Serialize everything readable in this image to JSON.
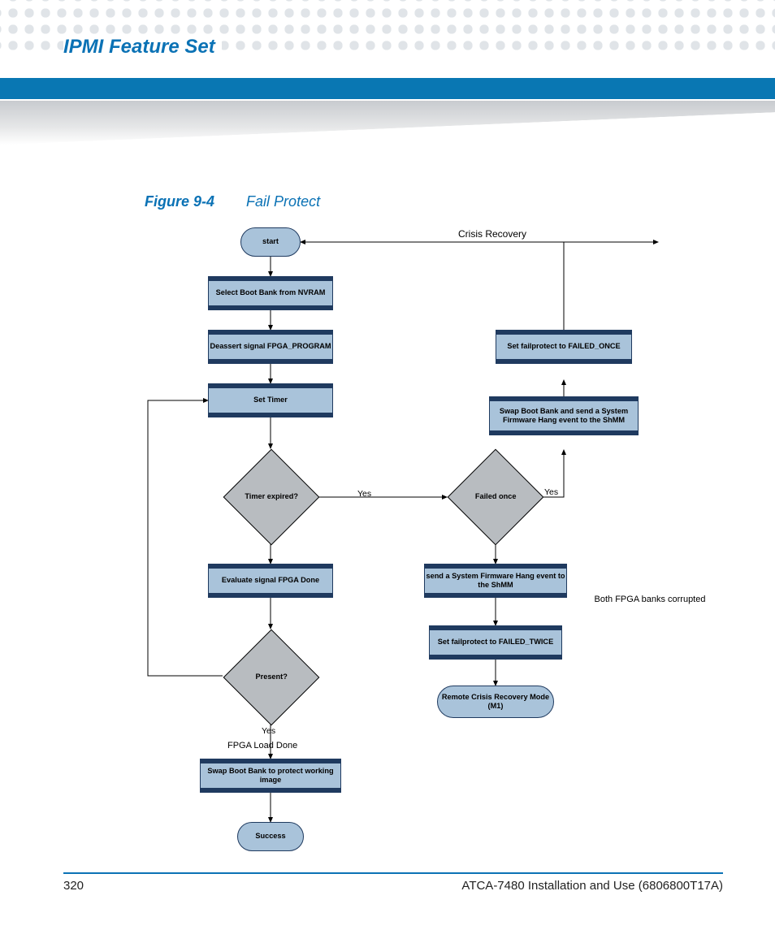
{
  "header": {
    "section_title": "IPMI Feature Set"
  },
  "figure": {
    "number": "Figure 9-4",
    "title": "Fail Protect"
  },
  "flow": {
    "start": "start",
    "select_boot": "Select Boot Bank from NVRAM",
    "deassert": "Deassert signal FPGA_PROGRAM",
    "set_timer": "Set Timer",
    "timer_expired": "Timer expired?",
    "eval_fpga": "Evaluate signal FPGA Done",
    "present": "Present?",
    "fpga_load_done": "FPGA Load Done",
    "swap_protect": "Swap Boot Bank to protect working image",
    "success": "Success",
    "failed_once_q": "Failed once",
    "send_hang": "send a System Firmware Hang event to the ShMM",
    "set_failed_twice": "Set failprotect to FAILED_TWICE",
    "remote_crisis": "Remote Crisis Recovery Mode (M1)",
    "swap_send": "Swap Boot Bank and send a System Firmware Hang event to the ShMM",
    "set_failed_once": "Set failprotect to FAILED_ONCE",
    "crisis_recovery": "Crisis Recovery",
    "both_corrupted": "Both FPGA banks corrupted",
    "yes1": "Yes",
    "yes2": "Yes",
    "yes3": "Yes"
  },
  "footer": {
    "page_number": "320",
    "doc_title": "ATCA-7480 Installation and Use (6806800T17A)"
  }
}
